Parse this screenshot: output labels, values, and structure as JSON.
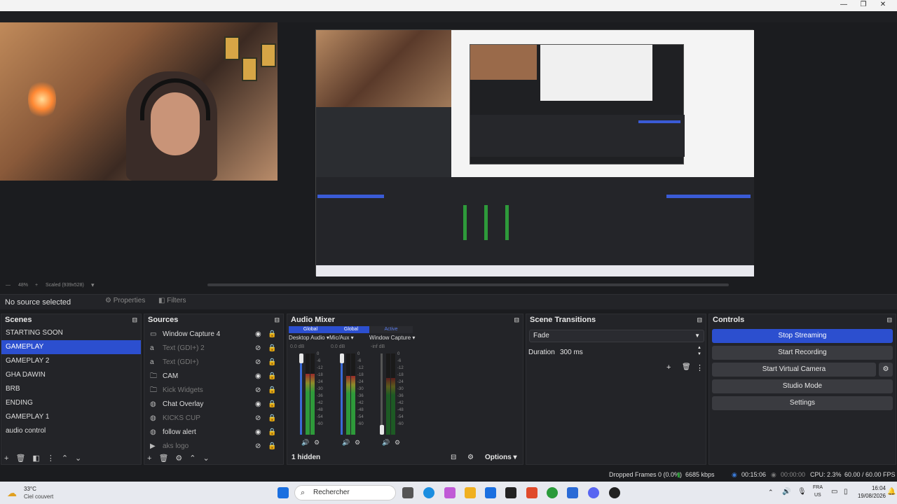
{
  "window": {
    "minimize": "—",
    "maximize": "❐",
    "close": "✕"
  },
  "preview": {
    "zoom_text": "48%",
    "scaled_text": "Scaled (939x528)"
  },
  "properties_bar": {
    "no_source": "No source selected",
    "properties": "Properties",
    "filters": "Filters"
  },
  "scenes": {
    "title": "Scenes",
    "items": [
      "STARTING SOON",
      "GAMEPLAY",
      "GAMEPLAY 2",
      "GHA DAWIN",
      "BRB",
      "ENDING",
      "GAMEPLAY 1",
      "audio control"
    ],
    "active_index": 1
  },
  "sources": {
    "title": "Sources",
    "items": [
      {
        "name": "Window Capture 4",
        "icon": "window-icon",
        "dim": false
      },
      {
        "name": "Text (GDI+) 2",
        "icon": "text-icon",
        "dim": true
      },
      {
        "name": "Text (GDI+)",
        "icon": "text-icon",
        "dim": true
      },
      {
        "name": "CAM",
        "icon": "folder-icon",
        "dim": false
      },
      {
        "name": "Kick Widgets",
        "icon": "folder-icon",
        "dim": true
      },
      {
        "name": "Chat Overlay",
        "icon": "browser-icon",
        "dim": false
      },
      {
        "name": "KICKS CUP",
        "icon": "browser-icon",
        "dim": true
      },
      {
        "name": "follow alert",
        "icon": "browser-icon",
        "dim": false
      },
      {
        "name": "aks logo",
        "icon": "media-icon",
        "dim": true
      }
    ]
  },
  "mixer": {
    "title": "Audio Mixer",
    "tabs": [
      "Global",
      "Global",
      "Active"
    ],
    "channels": [
      {
        "name": "Desktop Audio",
        "db": "0.0 dB",
        "level": 0.75
      },
      {
        "name": "Mic/Aux",
        "db": "0.0 dB",
        "level": 0.72
      },
      {
        "name": "Window Capture",
        "db": "-inf dB",
        "level": 0.7
      }
    ],
    "ticks": [
      "0",
      "-6",
      "-12",
      "-18",
      "-24",
      "-30",
      "-36",
      "-42",
      "-48",
      "-54",
      "-60"
    ],
    "hidden_label": "1 hidden",
    "options_label": "Options"
  },
  "transitions": {
    "title": "Scene Transitions",
    "selected": "Fade",
    "duration_label": "Duration",
    "duration_value": "300 ms"
  },
  "controls": {
    "title": "Controls",
    "buttons": [
      "Stop Streaming",
      "Start Recording",
      "Start Virtual Camera",
      "Studio Mode",
      "Settings"
    ]
  },
  "status": {
    "dropped": "Dropped Frames 0 (0.0%)",
    "kbps": "6685 kbps",
    "stream_time": "00:15:06",
    "rec_time": "00:00:00",
    "cpu": "CPU: 2.3%",
    "fps": "60.00 / 60.00 FPS"
  },
  "taskbar": {
    "weather_temp": "33°C",
    "weather_desc": "Ciel couvert",
    "search_placeholder": "Rechercher",
    "lang_top": "FRA",
    "lang_bottom": "US",
    "time": "16:04",
    "date": "19/08/2026"
  }
}
